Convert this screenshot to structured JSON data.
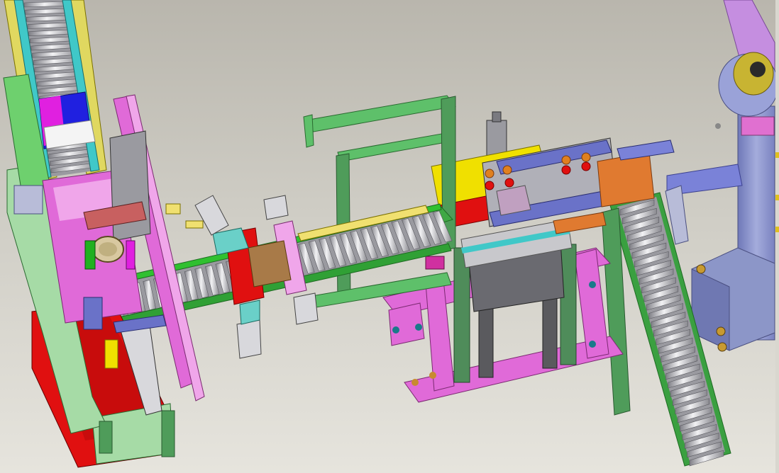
{
  "scene": {
    "title": "",
    "colors": {
      "background_top": "#b9b6ad",
      "background_bottom": "#e6e4dd",
      "frame_green": "#4f9c5a",
      "pale_green": "#a6dba6",
      "base_magenta": "#e06ad8",
      "light_pink": "#f0a6ea",
      "red_plate": "#e01010",
      "yellow_rail": "#f0e070",
      "cyan_rail": "#40c8c8",
      "roller_gray": "#c8c8cc",
      "roller_dark": "#8c8c92",
      "slate_blue": "#7a82d8",
      "dark_gray": "#5a5a5e",
      "orange_block": "#e08020",
      "purple_robot": "#c58ee0",
      "steel_blue_column": "#8c96c8",
      "gold_flange": "#c8b432",
      "bright_green": "#30c030",
      "pink_accent": "#ff40a0"
    },
    "assemblies": [
      {
        "name": "left-infeed-conveyor",
        "icon": "roller-conveyor-icon"
      },
      {
        "name": "left-red-base-plate",
        "icon": "base-plate-icon"
      },
      {
        "name": "center-roller-conveyor",
        "icon": "roller-conveyor-icon"
      },
      {
        "name": "green-gantry-frame",
        "icon": "frame-icon"
      },
      {
        "name": "pneumatic-cylinders",
        "icon": "cylinder-icon"
      },
      {
        "name": "central-press-station",
        "icon": "press-icon"
      },
      {
        "name": "magenta-base-frame",
        "icon": "base-frame-icon"
      },
      {
        "name": "right-inclined-conveyor",
        "icon": "roller-conveyor-icon"
      },
      {
        "name": "robot-arm-column",
        "icon": "robot-icon"
      }
    ]
  }
}
